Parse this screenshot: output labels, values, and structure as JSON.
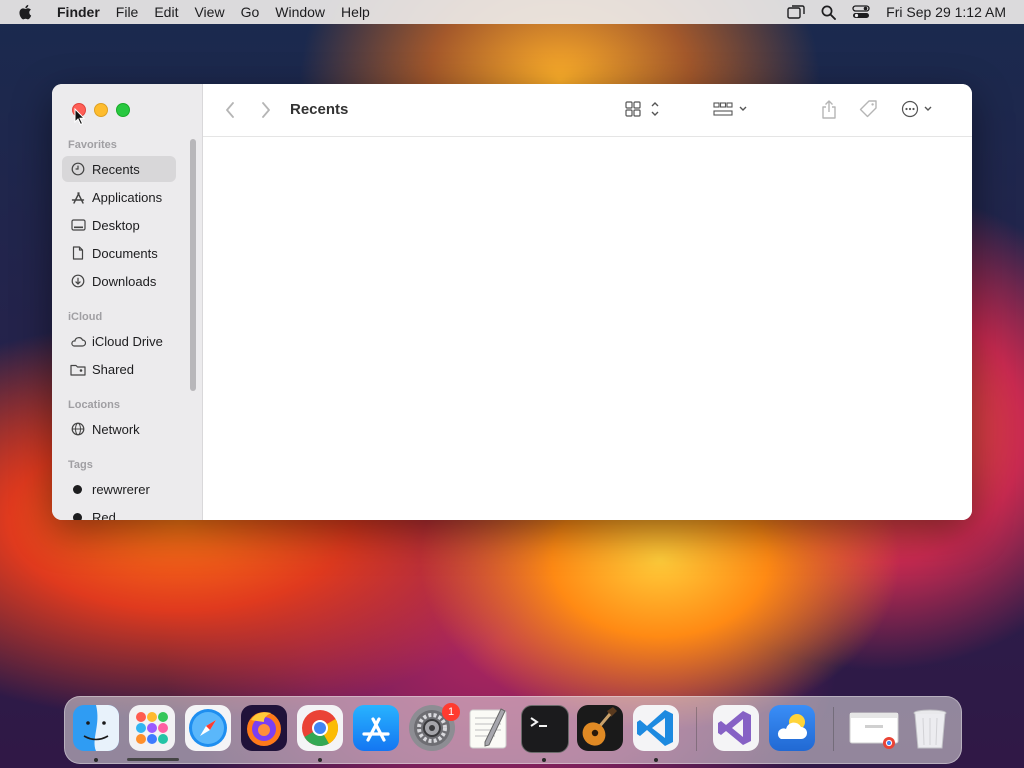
{
  "menubar": {
    "app_name": "Finder",
    "items": [
      "File",
      "Edit",
      "View",
      "Go",
      "Window",
      "Help"
    ],
    "clock": "Fri Sep 29  1:12 AM",
    "status_icons": [
      "screen-mirroring-icon",
      "spotlight-search-icon",
      "control-center-icon"
    ]
  },
  "finder": {
    "title": "Recents",
    "sidebar": {
      "favorites_title": "Favorites",
      "favorites": [
        {
          "label": "Recents",
          "icon": "clock-icon",
          "selected": true
        },
        {
          "label": "Applications",
          "icon": "applications-icon"
        },
        {
          "label": "Desktop",
          "icon": "desktop-icon"
        },
        {
          "label": "Documents",
          "icon": "document-icon"
        },
        {
          "label": "Downloads",
          "icon": "download-icon"
        }
      ],
      "icloud_title": "iCloud",
      "icloud": [
        {
          "label": "iCloud Drive",
          "icon": "cloud-icon"
        },
        {
          "label": "Shared",
          "icon": "shared-folder-icon"
        }
      ],
      "locations_title": "Locations",
      "locations": [
        {
          "label": "Network",
          "icon": "globe-icon"
        }
      ],
      "tags_title": "Tags",
      "tags": [
        {
          "label": "rewwrerer",
          "color": "#1d1d1f"
        },
        {
          "label": "Red",
          "color": "#1d1d1f"
        }
      ]
    },
    "toolbar_icons": [
      "back-icon",
      "forward-icon",
      "icon-view-icon",
      "group-icon",
      "share-icon",
      "tag-icon",
      "more-actions-icon",
      "search-icon"
    ]
  },
  "dock": {
    "apps": [
      "Finder",
      "Launchpad",
      "Safari",
      "Firefox",
      "Google Chrome",
      "App Store",
      "System Settings",
      "TextEdit",
      "Terminal",
      "GarageBand",
      "Visual Studio Code",
      "Visual Studio",
      "Weather",
      "Chrome Window",
      "Trash"
    ],
    "settings_badge": "1"
  },
  "colors": {
    "close": "#ff5f57",
    "minimize": "#febc2e",
    "zoom": "#28c840",
    "sidebar_bg": "#ecebed",
    "selected_item": "#d8d7d9"
  }
}
